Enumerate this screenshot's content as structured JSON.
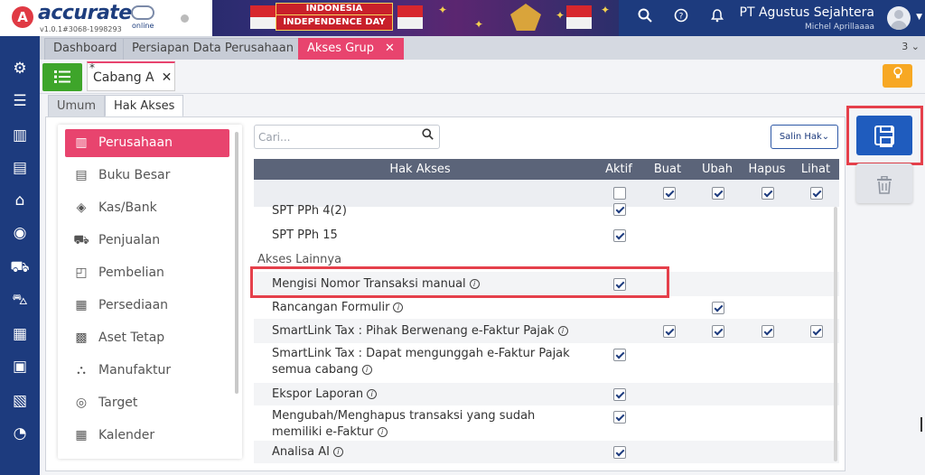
{
  "brand": {
    "logo_letter": "A",
    "name": "accurate",
    "suffix": "online",
    "version": "v1.0.1#3068-1998293"
  },
  "banner": {
    "line1": "INDONESIA",
    "line2": "INDEPENDENCE DAY"
  },
  "header": {
    "company": "PT Agustus Sejahtera",
    "user": "Michel Aprillaaaa"
  },
  "tabs": [
    {
      "label": "Dashboard"
    },
    {
      "label": "Persiapan Data Perusahaan"
    },
    {
      "label": "Akses Grup",
      "close": "✕"
    }
  ],
  "tab_count": "3 ⌄",
  "subtab": {
    "star": "*",
    "label": "Cabang A",
    "close": "✕"
  },
  "inner_tabs": [
    {
      "label": "Umum"
    },
    {
      "label": "Hak Akses"
    }
  ],
  "categories": [
    {
      "label": "Perusahaan",
      "icon": "building-icon"
    },
    {
      "label": "Buku Besar",
      "icon": "ledger-icon"
    },
    {
      "label": "Kas/Bank",
      "icon": "cash-icon"
    },
    {
      "label": "Penjualan",
      "icon": "cart-icon"
    },
    {
      "label": "Pembelian",
      "icon": "bag-icon"
    },
    {
      "label": "Persediaan",
      "icon": "inventory-icon"
    },
    {
      "label": "Aset Tetap",
      "icon": "asset-icon"
    },
    {
      "label": "Manufaktur",
      "icon": "factory-icon"
    },
    {
      "label": "Target",
      "icon": "target-icon"
    },
    {
      "label": "Kalender",
      "icon": "calendar-icon"
    }
  ],
  "search": {
    "placeholder": "Cari..."
  },
  "salin_label": "Salin Hak⌄",
  "table": {
    "headers": [
      "Hak Akses",
      "Aktif",
      "Buat",
      "Ubah",
      "Hapus",
      "Lihat"
    ],
    "header_checks": [
      false,
      true,
      true,
      true,
      true
    ],
    "rows": [
      {
        "label": "SPT PPh 4(2)",
        "checks": [
          true,
          null,
          null,
          null,
          null
        ]
      },
      {
        "label": "SPT PPh 15",
        "checks": [
          true,
          null,
          null,
          null,
          null
        ]
      },
      {
        "label": "Akses Lainnya",
        "section": true
      },
      {
        "label": "Mengisi Nomor Transaksi manual",
        "info": true,
        "checks": [
          true,
          null,
          null,
          null,
          null
        ]
      },
      {
        "label": "Rancangan Formulir",
        "info": true,
        "checks": [
          null,
          null,
          true,
          null,
          null
        ]
      },
      {
        "label": "SmartLink Tax : Pihak Berwenang e-Faktur Pajak",
        "info": true,
        "checks": [
          null,
          true,
          true,
          true,
          true
        ]
      },
      {
        "label": "SmartLink Tax : Dapat mengunggah e-Faktur Pajak semua cabang",
        "info": true,
        "checks": [
          true,
          null,
          null,
          null,
          null
        ]
      },
      {
        "label": "Ekspor Laporan",
        "info": true,
        "checks": [
          true,
          null,
          null,
          null,
          null
        ]
      },
      {
        "label": "Mengubah/Menghapus transaksi yang sudah memiliki e-Faktur",
        "info": true,
        "checks": [
          true,
          null,
          null,
          null,
          null
        ]
      },
      {
        "label": "Analisa AI",
        "info": true,
        "checks": [
          true,
          null,
          null,
          null,
          null
        ]
      }
    ]
  },
  "colors": {
    "primary": "#1d3b7e",
    "accent": "#e8446e",
    "save": "#1f5cbe",
    "highlight": "#e5404b",
    "green": "#3ea52a",
    "amber": "#f7a823"
  }
}
